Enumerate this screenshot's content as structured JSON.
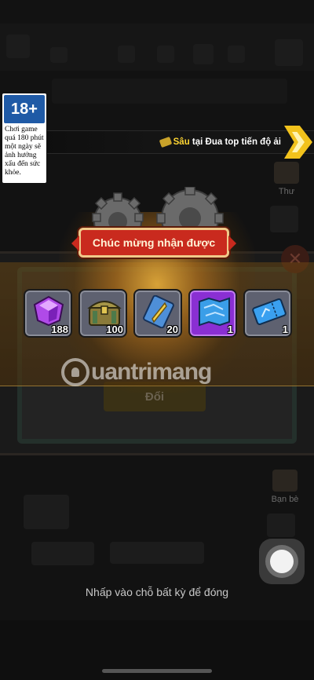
{
  "background": {
    "side_menu": [
      {
        "label": "Thư"
      },
      {
        "label": "Bạn bè"
      }
    ],
    "exchange_button_label": "Đổi",
    "close_symbol": "✕"
  },
  "rating": {
    "badge": "18+",
    "warning": "Chơi game quá 180 phút một ngày sẽ ảnh hưởng xấu đến sức khỏe."
  },
  "ticker": {
    "player_name": "Sâu",
    "message": " tại Đua top tiến độ ải"
  },
  "reward": {
    "title": "Chúc mừng nhận được",
    "items": [
      {
        "icon": "purple-gem-icon",
        "count": "188",
        "rarity": "normal"
      },
      {
        "icon": "treasure-chest-icon",
        "count": "100",
        "rarity": "normal"
      },
      {
        "icon": "scroll-card-icon",
        "count": "20",
        "rarity": "normal"
      },
      {
        "icon": "blueprint-map-icon",
        "count": "1",
        "rarity": "epic"
      },
      {
        "icon": "blue-ticket-icon",
        "count": "1",
        "rarity": "normal"
      }
    ]
  },
  "watermark": {
    "text": "uantrimang"
  },
  "tap_to_close": "Nhấp vào chỗ bất kỳ để đóng",
  "colors": {
    "banner_red": "#c92a1e",
    "epic_purple": "#8a2fd3",
    "ticker_yellow": "#ffd633"
  }
}
